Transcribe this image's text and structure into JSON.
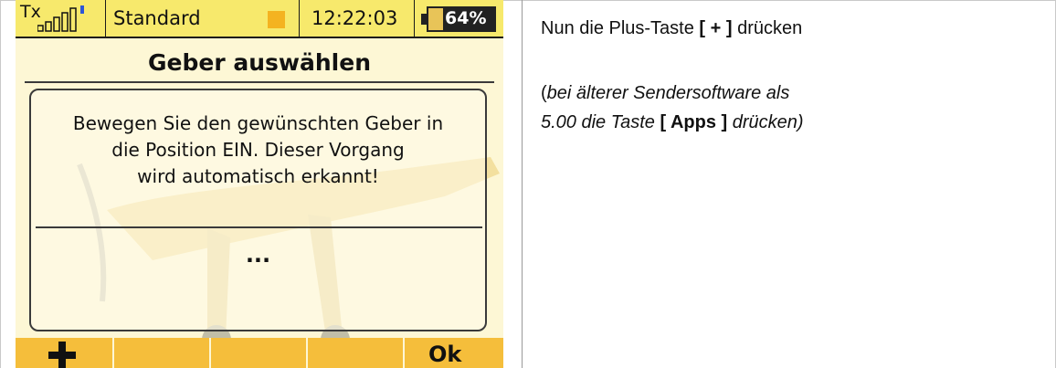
{
  "statusbar": {
    "tx_label": "Tx",
    "profile": "Standard",
    "time": "12:22:03",
    "battery": "64%",
    "battery_level": 0.64
  },
  "screen": {
    "title": "Geber auswählen",
    "message": "Bewegen Sie den gewünschten Geber in\ndie Position EIN. Dieser Vorgang\nwird automatisch erkannt!",
    "waiting": "...",
    "softkeys": {
      "key1_icon": "plus-icon",
      "key5_label": "Ok"
    }
  },
  "instructions": {
    "line1_pre": "Nun die Plus-Taste ",
    "line1_key": "[ + ]",
    "line1_post": " drücken",
    "note_open": "(",
    "note_italic1": "bei älterer Sendersoftware als",
    "note_italic2": " 5.00 die Taste ",
    "note_key": "[ Apps ]",
    "note_italic3": " drücken)"
  },
  "colors": {
    "statusbar_bg": "#f7e96c",
    "screen_bg": "#fdf7d5",
    "softkey_bg": "#f5be3b",
    "accent_orange": "#f4b320"
  }
}
